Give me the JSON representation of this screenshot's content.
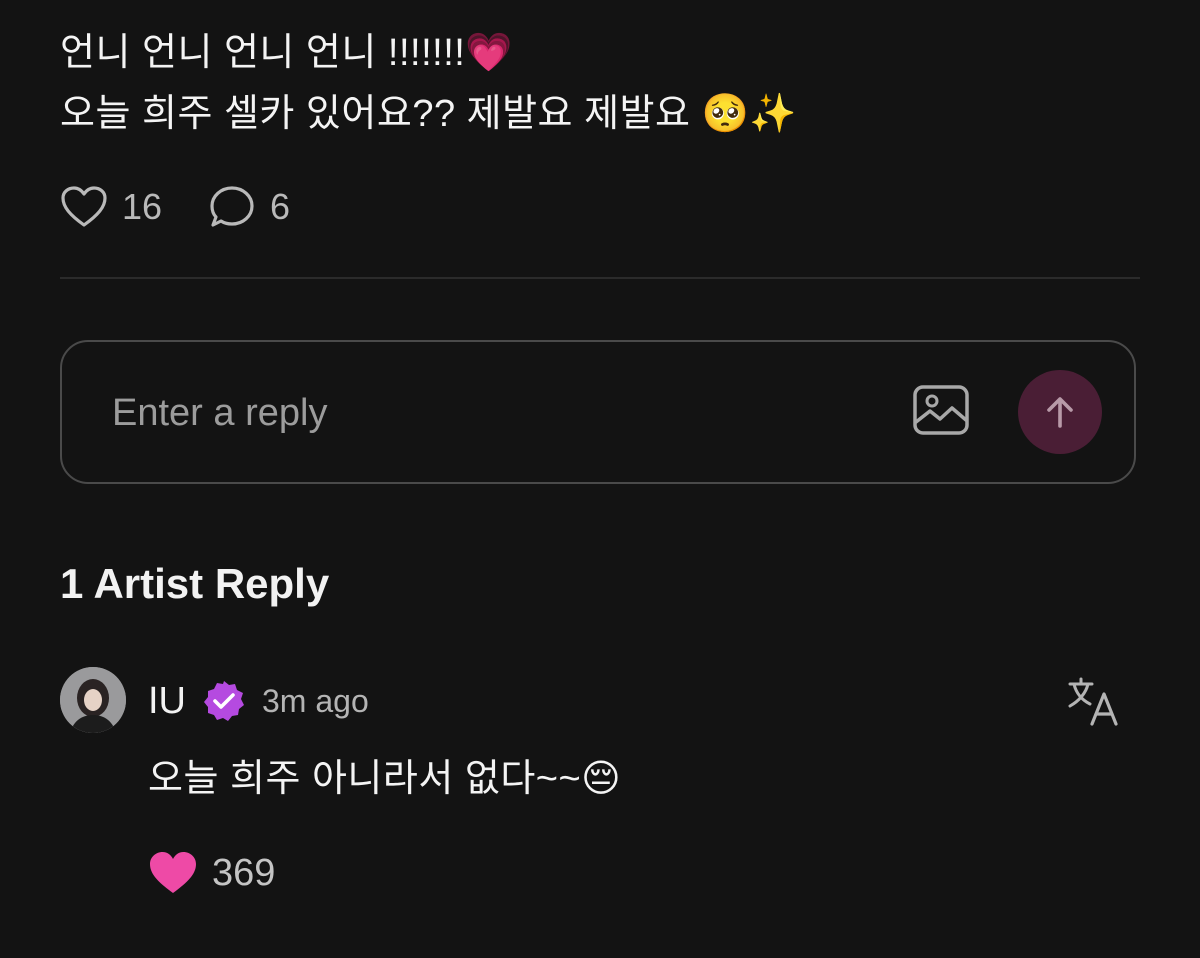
{
  "post": {
    "line1": "언니 언니 언니 언니 !!!!!!!",
    "line1_emoji": "💗",
    "line2": "오늘 희주 셀카 있어요?? 제발요 제발요 ",
    "line2_emoji": "🥺✨"
  },
  "stats": {
    "likes": "16",
    "comments": "6"
  },
  "reply_box": {
    "placeholder": "Enter a reply"
  },
  "section": {
    "title": "1 Artist Reply"
  },
  "artist_reply": {
    "author": "IU",
    "time": "3m ago",
    "text": "오늘 희주 아니라서 없다~~",
    "emoji": "😔",
    "likes": "369"
  },
  "icons": {
    "heart": "heart-outline-icon",
    "comment": "comment-bubble-icon",
    "image": "image-icon",
    "send": "arrow-up-icon",
    "verified": "verified-badge-icon",
    "translate": "translate-icon",
    "liked": "heart-filled-icon"
  },
  "colors": {
    "background": "#131313",
    "send_button": "#4a1e35",
    "verified": "#b54ae0",
    "liked_heart": "#ee4aa6"
  }
}
